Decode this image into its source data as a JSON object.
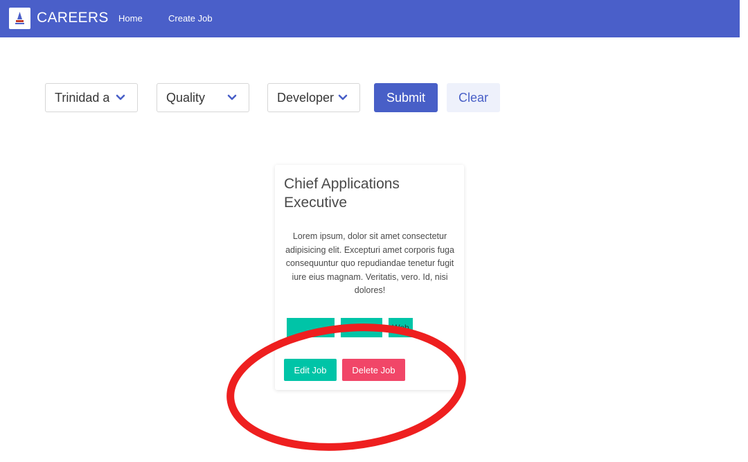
{
  "navbar": {
    "brand": "CAREERS",
    "links": [
      "Home",
      "Create Job"
    ],
    "color": "#4a5fc9"
  },
  "filters": {
    "location": "Trinidad a",
    "department": "Quality",
    "role": "Developer",
    "submit_label": "Submit",
    "clear_label": "Clear"
  },
  "job": {
    "title": "Chief Applications Executive",
    "description": "Lorem ipsum, dolor sit amet consectetur adipisicing elit. Excepturi amet corporis fuga consequuntur quo repudiandae tenetur fugit iure eius magnam. Veritatis, vero. Id, nisi dolores!",
    "tags": [
      "",
      "",
      "Web"
    ],
    "edit_label": "Edit Job",
    "delete_label": "Delete Job"
  },
  "colors": {
    "primary": "#485fc7",
    "success": "#00c4a7",
    "danger": "#f14668",
    "annotation": "#ee1f1f"
  }
}
